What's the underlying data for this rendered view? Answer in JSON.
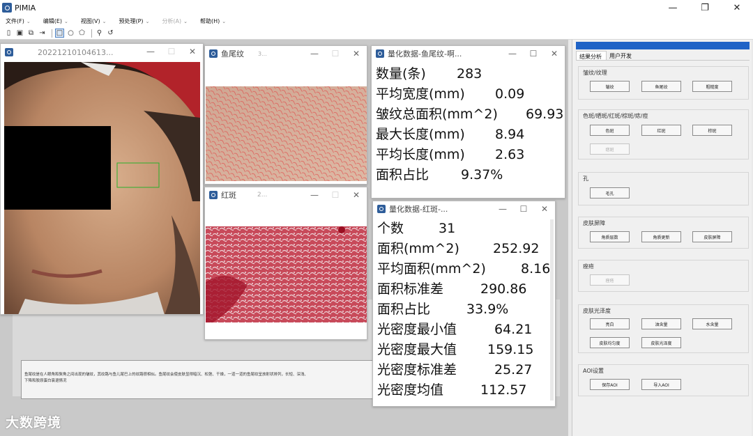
{
  "app": {
    "title": "PIMIA"
  },
  "window_controls": {
    "minimize": "—",
    "maximize": "❐",
    "close": "✕"
  },
  "menu": [
    {
      "label": "文件(F)",
      "chevron": "⌄"
    },
    {
      "label": "编辑(E)",
      "chevron": "⌄"
    },
    {
      "label": "视图(V)",
      "chevron": "⌄"
    },
    {
      "label": "预处理(P)",
      "chevron": "⌄"
    },
    {
      "label": "分析(A)",
      "chevron": "⌄"
    },
    {
      "label": "帮助(H)",
      "chevron": "⌄"
    }
  ],
  "toolbar_icons": [
    "columns-icon",
    "save-icon",
    "copy-icon",
    "export-icon",
    "rectangle-select-icon",
    "circle-select-icon",
    "polygon-select-icon",
    "zoom-icon",
    "rotate-icon"
  ],
  "windows": {
    "face": {
      "title": "20221210104613...",
      "min": "—",
      "max": "☐",
      "close": "✕"
    },
    "crowsfeet": {
      "title": "鱼尾纹",
      "extra": "3...",
      "min": "—",
      "max": "☐",
      "close": "✕"
    },
    "erythema": {
      "title": "红斑",
      "extra": "2...",
      "min": "—",
      "max": "☐",
      "close": "✕"
    },
    "quant_crowsfeet": {
      "title": "量化数据-鱼尾纹-啊...",
      "min": "—",
      "max": "☐",
      "close": "✕",
      "rows": [
        {
          "key": "数量(条)",
          "value": "283"
        },
        {
          "key": "平均宽度(mm)",
          "value": "0.09"
        },
        {
          "key": "皱纹总面积(mm^2)",
          "value": "69.93"
        },
        {
          "key": "最大长度(mm)",
          "value": "8.94"
        },
        {
          "key": "平均长度(mm)",
          "value": "2.63"
        },
        {
          "key": "面积占比",
          "value": "9.37%"
        }
      ]
    },
    "quant_erythema": {
      "title": "量化数据-红斑-...",
      "min": "—",
      "max": "☐",
      "close": "✕",
      "rows": [
        {
          "key": "个数",
          "value": "31"
        },
        {
          "key": "面积(mm^2)",
          "value": "252.92"
        },
        {
          "key": "平均面积(mm^2)",
          "value": "8.16"
        },
        {
          "key": "面积标准差",
          "value": "290.86"
        },
        {
          "key": "面积占比",
          "value": "33.9%"
        },
        {
          "key": "光密度最小值",
          "value": "64.21"
        },
        {
          "key": "光密度最大值",
          "value": "159.15"
        },
        {
          "key": "光密度标准差",
          "value": "25.27"
        },
        {
          "key": "光密度均值",
          "value": "112.57"
        }
      ]
    }
  },
  "description": {
    "line1": "鱼尾纹是在人眼角和鬓角之间出现的皱纹，其纹路与鱼儿尾巴上的纹路很相似。鱼尾纹会使皮肤显得暗沉、松弛、干燥，一道一道的鱼尾纹呈放射状排列，长短、深浅、",
    "line2": "下降和胶原蛋白衰退情况"
  },
  "right_panel": {
    "tabs": [
      "结果分析",
      "用户开发"
    ],
    "groups": {
      "wrinkle": {
        "title": "皱纹/纹理",
        "buttons": [
          "皱纹",
          "鱼尾纹",
          "粗糙度"
        ]
      },
      "spots": {
        "title": "色斑/晒斑/红斑/棕斑/痣/痘",
        "buttons": [
          "色斑",
          "红斑",
          "棕斑",
          "痣斑"
        ]
      },
      "pore": {
        "title": "孔",
        "buttons": [
          "毛孔"
        ]
      },
      "barrier": {
        "title": "皮肤屏障",
        "buttons": [
          "角质层数",
          "角质更新",
          "皮肤屏障"
        ]
      },
      "acne": {
        "title": "痤疮",
        "buttons": [
          "痤疮"
        ]
      },
      "gloss": {
        "title": "皮肤光泽度",
        "buttons": [
          "亮白",
          "油含量",
          "水含量",
          "皮肤均匀度",
          "皮肤光泽度"
        ]
      },
      "aoi": {
        "title": "AOI设置",
        "buttons": [
          "保存AOI",
          "导入AOI"
        ]
      }
    }
  },
  "watermark": "大数跨境"
}
